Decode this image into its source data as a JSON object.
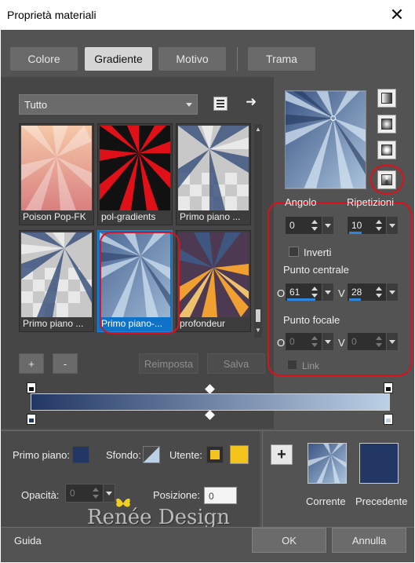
{
  "window": {
    "title": "Proprietà materiali"
  },
  "tabs": [
    {
      "label": "Colore",
      "active": false
    },
    {
      "label": "Gradiente",
      "active": true
    },
    {
      "label": "Motivo",
      "active": false
    },
    {
      "label": "Trama",
      "active": false
    }
  ],
  "library": {
    "category": "Tutto",
    "thumbnails": [
      {
        "label": "Poison Pop-FK",
        "selected": false
      },
      {
        "label": "pol-gradients",
        "selected": false
      },
      {
        "label": "Primo piano ...",
        "selected": false
      },
      {
        "label": "Primo piano ...",
        "selected": false
      },
      {
        "label": "Primo piano-...",
        "selected": true
      },
      {
        "label": "profondeur",
        "selected": false
      }
    ],
    "add_label": "+",
    "remove_label": "-",
    "reset_label": "Reimposta",
    "save_label": "Salva"
  },
  "properties": {
    "angle_label": "Angolo",
    "angle_value": "0",
    "repeats_label": "Ripetizioni",
    "repeats_value": "10",
    "invert_label": "Inverti",
    "center_label": "Punto centrale",
    "center_h_label": "O",
    "center_h_value": "61",
    "center_v_label": "V",
    "center_v_value": "28",
    "focal_label": "Punto focale",
    "focal_h_label": "O",
    "focal_h_value": "0",
    "focal_v_label": "V",
    "focal_v_value": "0",
    "link_label": "Link"
  },
  "bottom": {
    "foreground_label": "Primo piano:",
    "background_label": "Sfondo:",
    "user_label": "Utente:",
    "opacity_label": "Opacità:",
    "opacity_value": "0",
    "position_label": "Posizione:",
    "position_value": "0",
    "add_label": "+",
    "current_label": "Corrente",
    "previous_label": "Precedente",
    "watermark": "Renée Design"
  },
  "footer": {
    "help_label": "Guida",
    "ok_label": "OK",
    "cancel_label": "Annulla"
  },
  "colors": {
    "dark_blue": "#223763",
    "light_blue": "#bcd0e6",
    "user_yellow": "#f2c41c",
    "selection_blue": "#0e72c8",
    "highlight_red": "#e0101a"
  }
}
